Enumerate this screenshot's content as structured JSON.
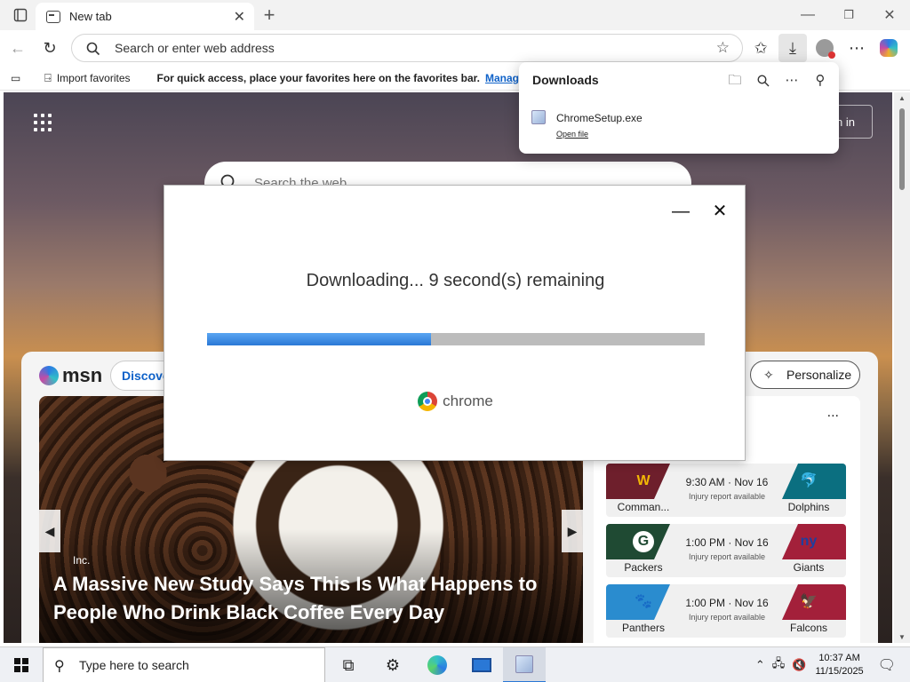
{
  "browser": {
    "tab_title": "New tab",
    "address_placeholder": "Search or enter web address"
  },
  "favorites_bar": {
    "import_label": "Import favorites",
    "message": "For quick access, place your favorites here on the favorites bar.",
    "manage_link": "Manage f"
  },
  "newtab": {
    "signin_label": "n in",
    "search_placeholder": "Search the web",
    "msn_logo": "msn",
    "discover_label": "Discove",
    "personalize_label": "Personalize",
    "hero": {
      "source": "Inc.",
      "headline": "A Massive New Study Says This Is What Happens to People Who Drink Black Coffee Every Day"
    },
    "sports": {
      "more_label": "...",
      "games": [
        {
          "team_left": "Comman...",
          "logo_left": "W",
          "team_right": "Dolphins",
          "logo_right": "🐬",
          "time": "9:30 AM · Nov 16",
          "note": "Injury report available",
          "color_left": "#6e1f2c",
          "color_right": "#0b6f80"
        },
        {
          "team_left": "Packers",
          "logo_left": "G",
          "team_right": "Giants",
          "logo_right": "ny",
          "time": "1:00 PM · Nov 16",
          "note": "Injury report available",
          "color_left": "#1f4a33",
          "color_right": "#a3203a"
        },
        {
          "team_left": "Panthers",
          "logo_left": "🐾",
          "team_right": "Falcons",
          "logo_right": "🦅",
          "time": "1:00 PM · Nov 16",
          "note": "Injury report available",
          "color_left": "#2a8ccf",
          "color_right": "#a3203a"
        }
      ]
    }
  },
  "downloads": {
    "title": "Downloads",
    "file_name": "ChromeSetup.exe",
    "open_label": "Open file"
  },
  "installer": {
    "status": "Downloading... 9 second(s) remaining",
    "progress": 0.45,
    "brand": "chrome"
  },
  "taskbar": {
    "search_placeholder": "Type here to search",
    "time": "10:37 AM",
    "date": "11/15/2025"
  },
  "colors": {
    "accent": "#2a78d6",
    "progress_track": "#bcbcbc"
  }
}
